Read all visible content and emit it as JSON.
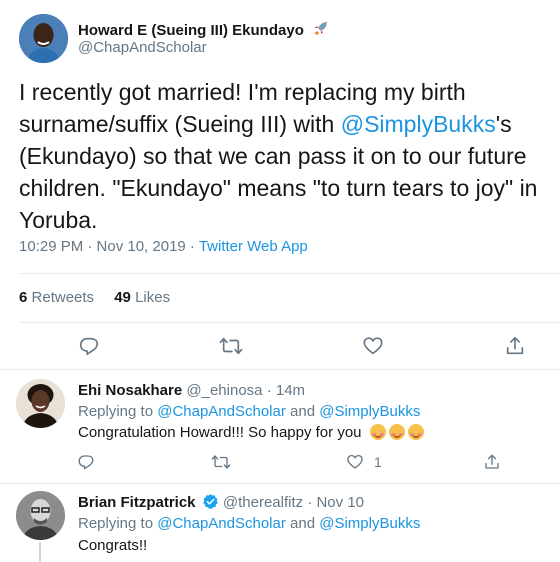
{
  "main_tweet": {
    "display_name": "Howard E (Sueing III) Ekundayo",
    "name_emoji": "🚀",
    "handle": "@ChapAndScholar",
    "text_part1": "I recently got married! I'm replacing my birth surname/suffix (Sueing III) with ",
    "mention": "@SimplyBukks",
    "text_part2": "'s (Ekundayo) so that we can pass it on to our future children. \"Ekundayo\" means \"to turn tears to joy\" in Yoruba.",
    "timestamp": "10:29 PM · Nov 10, 2019 · ",
    "source": "Twitter Web App",
    "retweets_count": "6",
    "retweets_label": "Retweets",
    "likes_count": "49",
    "likes_label": "Likes"
  },
  "replies": [
    {
      "display_name": "Ehi Nosakhare",
      "handle": "@_ehinosa",
      "time": "· 14m",
      "replying_label": "Replying to ",
      "replying_to_1": "@ChapAndScholar",
      "replying_and": " and ",
      "replying_to_2": "@SimplyBukks",
      "text": "Congratulation Howard!!! So happy for you",
      "like_count": "1"
    },
    {
      "display_name": "Brian Fitzpatrick",
      "handle": "@therealfitz",
      "time": "· Nov 10",
      "verified": true,
      "replying_label": "Replying to ",
      "replying_to_1": "@ChapAndScholar",
      "replying_and": " and ",
      "replying_to_2": "@SimplyBukks",
      "text": "Congrats!!"
    }
  ],
  "colors": {
    "link": "#1b95e0",
    "secondary_text": "#657786",
    "divider": "#e6ecf0"
  },
  "icons": [
    "reply-icon",
    "retweet-icon",
    "like-icon",
    "share-icon",
    "rocket-icon",
    "verified-badge-icon"
  ]
}
